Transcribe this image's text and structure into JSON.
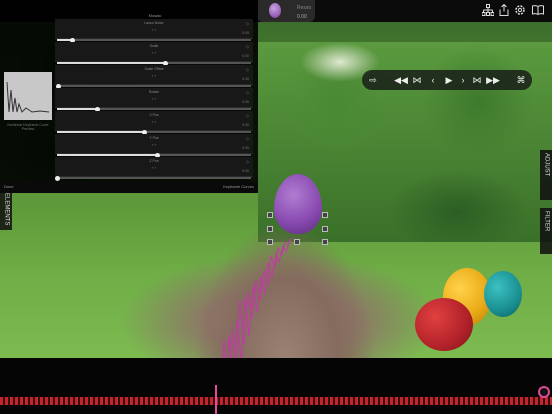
{
  "topbar": {
    "layer_name": "Resso",
    "layer_time": "0.00",
    "icons": [
      "hierarchy-icon",
      "share-icon",
      "settings-icon",
      "book-icon"
    ]
  },
  "keyframe_panel": {
    "title": "Mosaic",
    "rows": [
      {
        "name": "Lasso Noise",
        "value": "0.00",
        "fill": 0.08
      },
      {
        "name": "Scale",
        "value": "0.00",
        "fill": 0.56
      },
      {
        "name": "Scale Offset",
        "value": "0.00",
        "fill": 0.01
      },
      {
        "name": "Rotate",
        "value": "0.00",
        "fill": 0.21
      },
      {
        "name": "X Pos",
        "value": "0.00",
        "fill": 0.45
      },
      {
        "name": "Y Pos",
        "value": "0.00",
        "fill": 0.52
      },
      {
        "name": "Z Pos",
        "value": "0.00",
        "fill": 0.0
      }
    ],
    "thumb_label": "Nonlinear Keyframe Curve Preview",
    "bottom_left": "Done",
    "bottom_right": "Keyframe Curves"
  },
  "transport": {
    "buttons": [
      "export-icon",
      "rewind-icon",
      "step-back-key-icon",
      "prev-frame-icon",
      "play-icon",
      "next-frame-icon",
      "step-fwd-key-icon",
      "fast-forward-icon",
      "record-icon"
    ]
  },
  "side_tabs": {
    "adjust": "ADJUST",
    "filter": "FILTER",
    "elements": "ELEMENTS"
  },
  "colors": {
    "accent": "#e24a9a",
    "timeline_track": "#c0262d",
    "egg_purple": "#8a4bb2",
    "egg_red": "#b2222a",
    "egg_yellow": "#e8a814",
    "egg_teal": "#1a8f92"
  }
}
